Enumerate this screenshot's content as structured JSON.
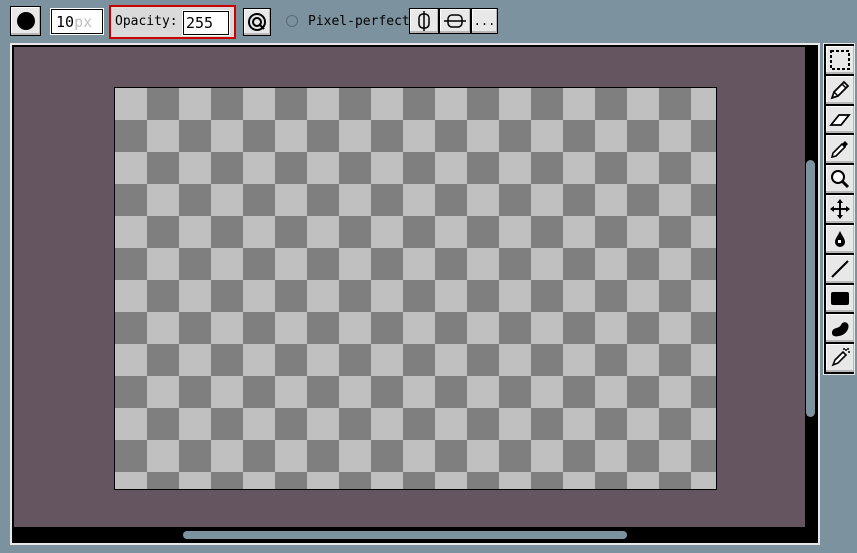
{
  "toolbar": {
    "brush_size_value": "10",
    "brush_size_unit": "px",
    "opacity_label": "Opacity:",
    "opacity_value": "255",
    "pixel_perfect_label": "Pixel-perfect",
    "more_label": "..."
  },
  "colors": {
    "background": "#7d929f",
    "canvas_area": "#655560",
    "checker_dark": "#7f7f7f",
    "checker_light": "#c0c0c0",
    "highlight": "#cc0000"
  },
  "tools": [
    {
      "name": "rectangular-marquee",
      "icon": "selection-icon"
    },
    {
      "name": "pencil",
      "icon": "pencil-icon"
    },
    {
      "name": "eraser",
      "icon": "eraser-icon"
    },
    {
      "name": "eyedropper",
      "icon": "eyedropper-icon"
    },
    {
      "name": "zoom",
      "icon": "zoom-icon"
    },
    {
      "name": "move",
      "icon": "move-icon"
    },
    {
      "name": "paint-bucket",
      "icon": "paint-bucket-icon"
    },
    {
      "name": "line",
      "icon": "line-icon"
    },
    {
      "name": "rectangle",
      "icon": "rectangle-icon"
    },
    {
      "name": "curve",
      "icon": "curve-icon"
    },
    {
      "name": "spray",
      "icon": "spray-icon"
    }
  ]
}
